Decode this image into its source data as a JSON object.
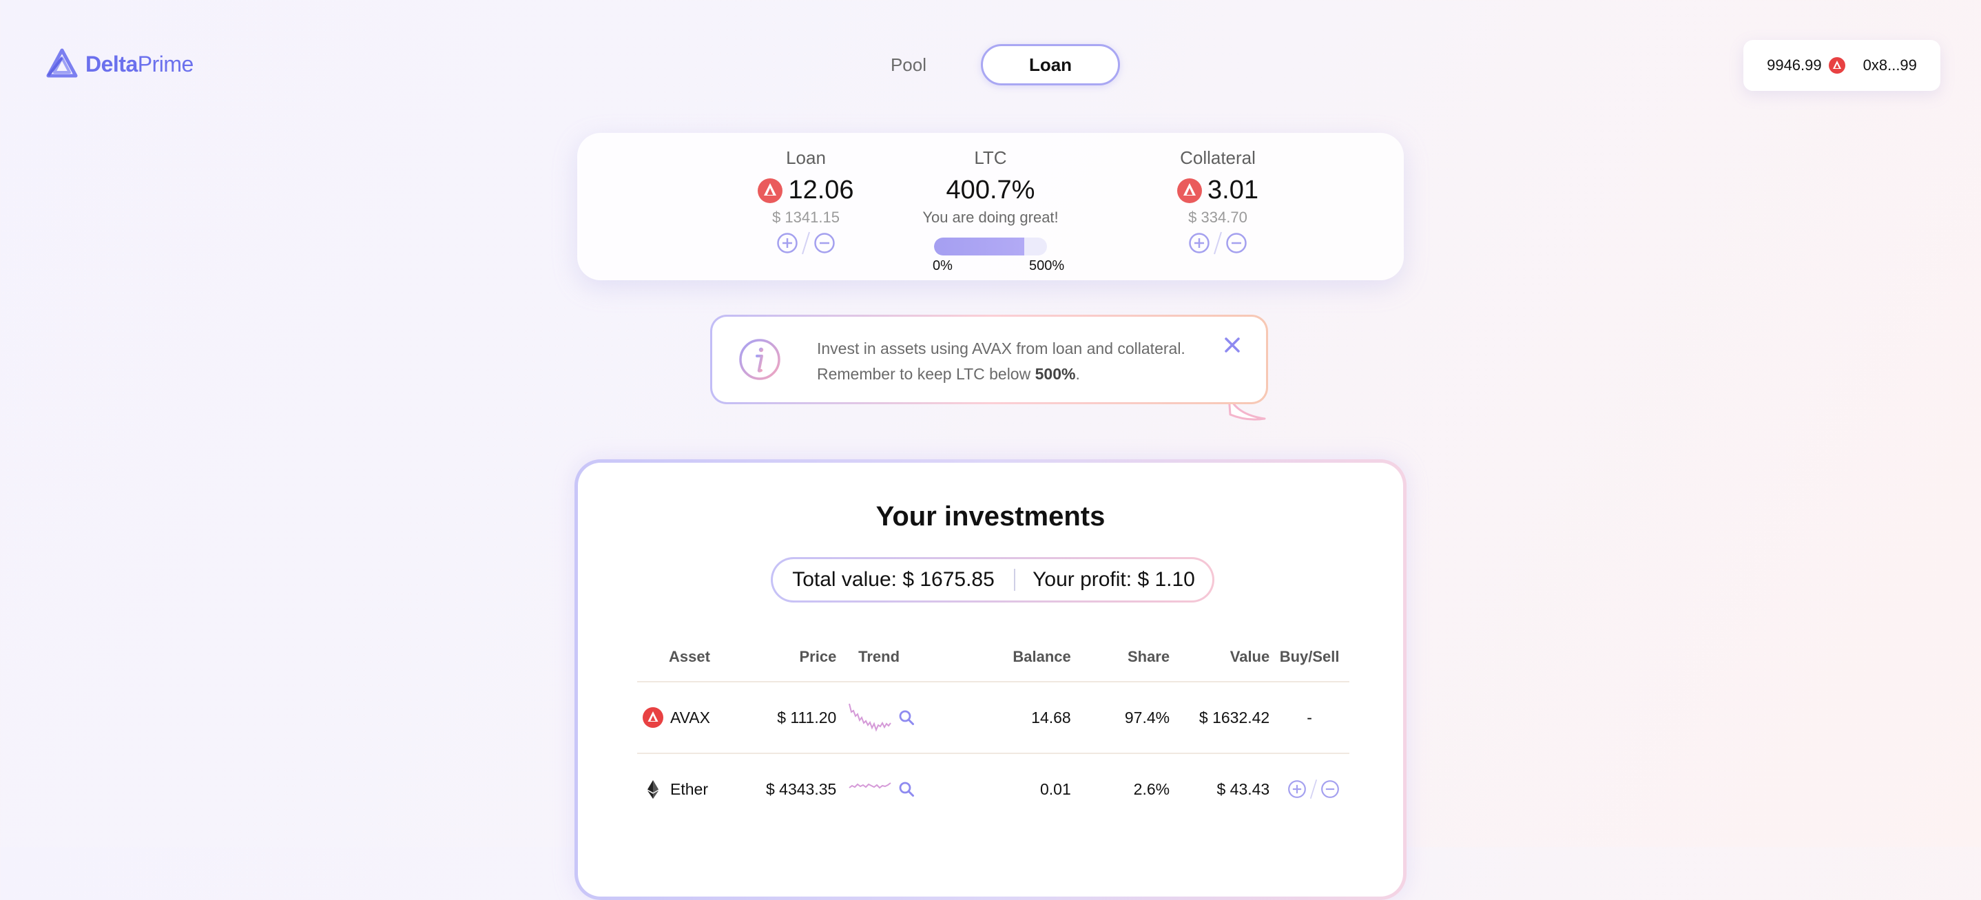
{
  "header": {
    "logo": {
      "bold": "Delta",
      "light": "Prime",
      "icon": "deltaprime-logo-icon"
    },
    "nav": [
      {
        "label": "Pool",
        "active": false
      },
      {
        "label": "Loan",
        "active": true
      }
    ],
    "wallet": {
      "balance": "9946.99",
      "token_icon": "avax-icon",
      "address": "0x8...99"
    }
  },
  "stats": {
    "loan": {
      "title": "Loan",
      "value": "12.06",
      "usd": "$ 1341.15"
    },
    "ltc": {
      "title": "LTC",
      "value": "400.7%",
      "message": "You are doing great!",
      "min_label": "0%",
      "max_label": "500%",
      "progress": 0.8
    },
    "collateral": {
      "title": "Collateral",
      "value": "3.01",
      "usd": "$ 334.70"
    }
  },
  "info": {
    "line1": "Invest in assets using AVAX from loan and collateral.",
    "line2_prefix": "Remember to keep LTC below ",
    "line2_bold": "500%",
    "line2_suffix": "."
  },
  "investments": {
    "title": "Your investments",
    "total_label": "Total value: ",
    "total_value": "$ 1675.85",
    "profit_label": "Your profit: ",
    "profit_value": "$ 1.10",
    "columns": [
      "Asset",
      "Price",
      "Trend",
      "Balance",
      "Share",
      "Value",
      "Buy/Sell"
    ],
    "rows": [
      {
        "asset": "AVAX",
        "icon": "avax-icon",
        "price": "$ 111.20",
        "balance": "14.68",
        "share": "97.4%",
        "value": "$ 1632.42",
        "buy_sell": "-"
      },
      {
        "asset": "Ether",
        "icon": "ether-icon",
        "price": "$ 4343.35",
        "balance": "0.01",
        "share": "2.6%",
        "value": "$ 43.43",
        "buy_sell": ""
      }
    ]
  },
  "colors": {
    "accent": "#6b70ed",
    "avax": "#e84142",
    "plus_minus": "#a4a0ef",
    "spark": "#d59ad8"
  }
}
